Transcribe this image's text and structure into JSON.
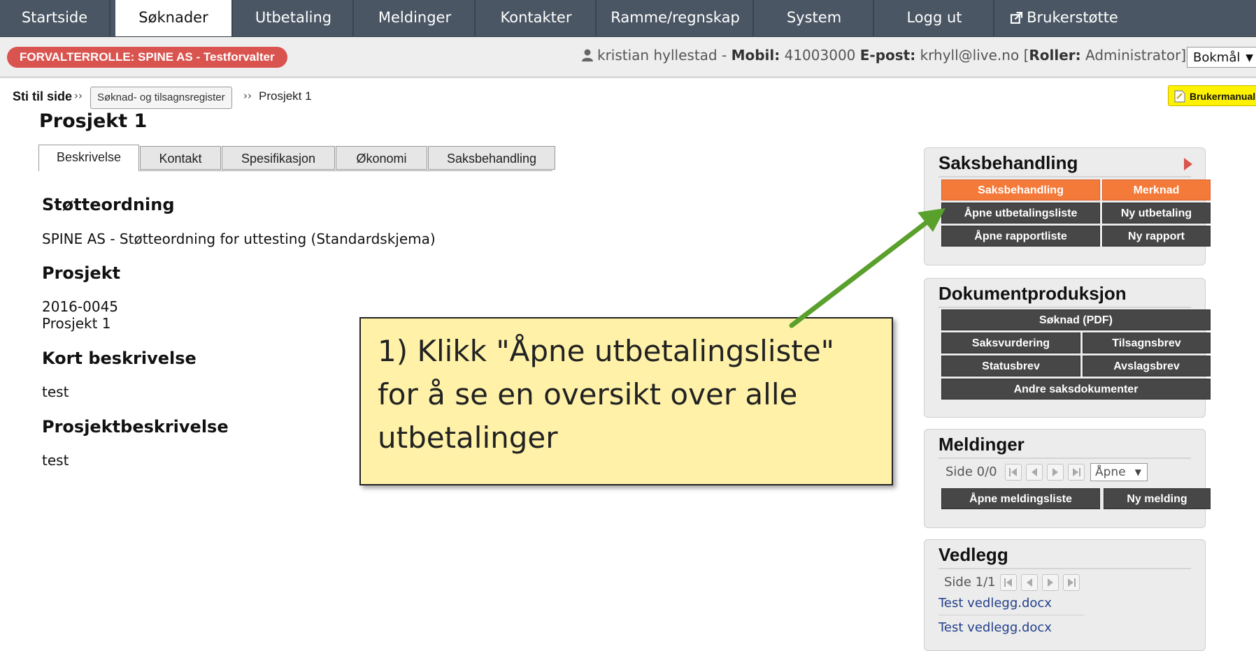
{
  "nav": {
    "items": [
      {
        "label": "Startside",
        "active": false
      },
      {
        "label": "Søknader",
        "active": true
      },
      {
        "label": "Utbetaling",
        "active": false
      },
      {
        "label": "Meldinger",
        "active": false
      },
      {
        "label": "Kontakter",
        "active": false
      },
      {
        "label": "Ramme/regnskap",
        "active": false
      },
      {
        "label": "System",
        "active": false
      },
      {
        "label": "Logg ut",
        "active": false
      },
      {
        "label": "Brukerstøtte",
        "active": false,
        "icon": "external-link-icon"
      }
    ]
  },
  "rolebar": {
    "role_badge": "FORVALTERROLLE: SPINE AS - Testforvalter",
    "user_name": "kristian hyllestad",
    "mobile_label": "Mobil:",
    "mobile_value": "41003000",
    "email_label": "E-post:",
    "email_value": "krhyll@live.no",
    "roles_label": "Roller:",
    "roles_value": "Administrator",
    "language": "Bokmål"
  },
  "breadcrumb": {
    "lead": "Sti til side",
    "sep": "››",
    "link": "Søknad- og tilsagnsregister",
    "current": "Prosjekt 1"
  },
  "manual_button": "Brukermanual",
  "page_title": "Prosjekt 1",
  "tabs": [
    {
      "label": "Beskrivelse",
      "active": true
    },
    {
      "label": "Kontakt",
      "active": false
    },
    {
      "label": "Spesifikasjon",
      "active": false
    },
    {
      "label": "Økonomi",
      "active": false
    },
    {
      "label": "Saksbehandling",
      "active": false
    }
  ],
  "content": {
    "stotteordning_heading": "Støtteordning",
    "stotteordning_text": "SPINE AS - Støtteordning for uttesting (Standardskjema)",
    "prosjekt_heading": "Prosjekt",
    "prosjekt_number": "2016-0045",
    "prosjekt_name": "Prosjekt 1",
    "kort_heading": "Kort beskrivelse",
    "kort_text": "test",
    "beskrivelse_heading": "Prosjektbeskrivelse",
    "beskrivelse_text": "test"
  },
  "panels": {
    "saksbehandling": {
      "title": "Saksbehandling",
      "buttons": [
        "Saksbehandling",
        "Merknad",
        "Åpne utbetalingsliste",
        "Ny utbetaling",
        "Åpne rapportliste",
        "Ny rapport"
      ]
    },
    "dokumentproduksjon": {
      "title": "Dokumentproduksjon",
      "buttons": [
        "Søknad (PDF)",
        "Saksvurdering",
        "Tilsagnsbrev",
        "Statusbrev",
        "Avslagsbrev",
        "Andre saksdokumenter"
      ]
    },
    "meldinger": {
      "title": "Meldinger",
      "pager": "Side 0/0",
      "filter": "Åpne",
      "buttons": [
        "Åpne meldingsliste",
        "Ny melding"
      ]
    },
    "vedlegg": {
      "title": "Vedlegg",
      "pager": "Side 1/1",
      "files": [
        "Test vedlegg.docx",
        "Test vedlegg.docx"
      ]
    }
  },
  "callout": {
    "text": "1) Klikk \"Åpne utbetalingsliste\" for å se en oversikt over alle utbetalinger"
  },
  "colors": {
    "nav_bg": "#4a5663",
    "role_badge": "#d9534f",
    "orange_button": "#f47a3a",
    "dark_button": "#474747",
    "callout_bg": "#fff2a8",
    "arrow": "#5aa02c"
  }
}
